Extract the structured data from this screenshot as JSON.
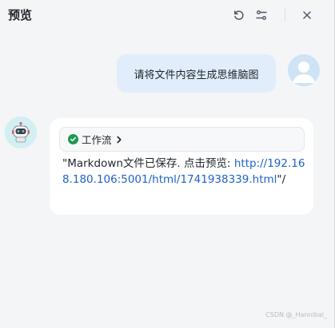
{
  "header": {
    "title": "预览",
    "icons": [
      "refresh-icon",
      "settings-sliders-icon",
      "close-icon"
    ]
  },
  "messages": {
    "user": {
      "text": "请将文件内容生成思维脑图"
    },
    "bot": {
      "workflow_label": "工作流",
      "prefix": "\"Markdown文件已保存. 点击预览: ",
      "link": "http://192.168.180.106:5001/html/1741938339.html",
      "suffix": "\"/"
    }
  },
  "watermark": "CSDN @_Hannibal_",
  "colors": {
    "background": "#f4f5f7",
    "user_bubble": "#e1edfb",
    "link": "#1e62c6",
    "success": "#1c9a4f"
  }
}
